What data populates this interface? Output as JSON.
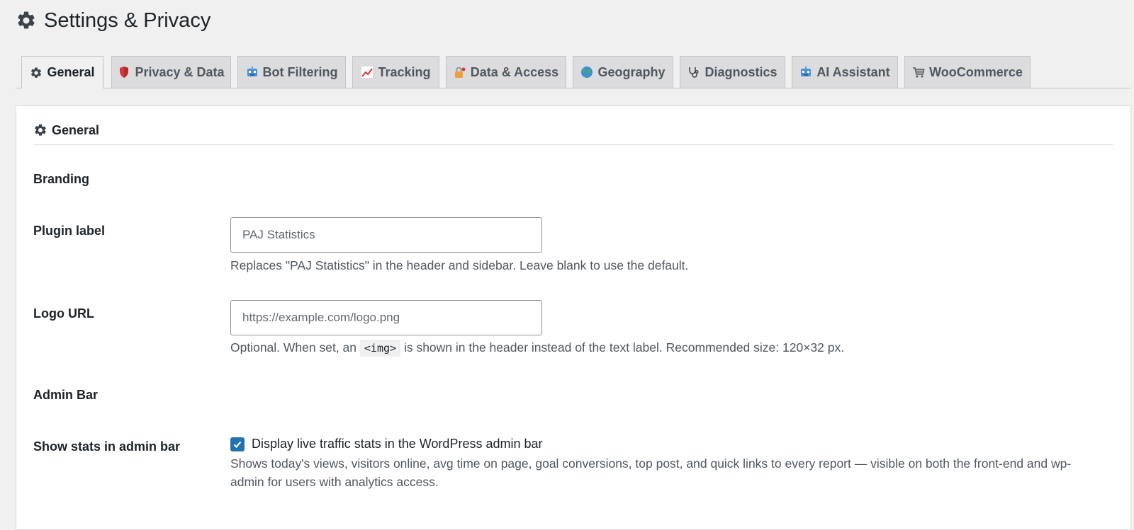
{
  "page": {
    "title": "Settings & Privacy"
  },
  "tabs": [
    {
      "label": "General",
      "icon": "gear-icon",
      "active": true
    },
    {
      "label": "Privacy & Data",
      "icon": "shield-icon",
      "active": false
    },
    {
      "label": "Bot Filtering",
      "icon": "robot-icon",
      "active": false
    },
    {
      "label": "Tracking",
      "icon": "chart-up-icon",
      "active": false
    },
    {
      "label": "Data & Access",
      "icon": "lock-key-icon",
      "active": false
    },
    {
      "label": "Geography",
      "icon": "globe-icon",
      "active": false
    },
    {
      "label": "Diagnostics",
      "icon": "stethoscope-icon",
      "active": false
    },
    {
      "label": "AI Assistant",
      "icon": "robot-icon",
      "active": false
    },
    {
      "label": "WooCommerce",
      "icon": "cart-icon",
      "active": false
    }
  ],
  "section": {
    "title": "General",
    "icon": "gear-icon"
  },
  "branding": {
    "heading": "Branding",
    "plugin_label": {
      "label": "Plugin label",
      "placeholder": "PAJ Statistics",
      "value": "",
      "description": "Replaces \"PAJ Statistics\" in the header and sidebar. Leave blank to use the default."
    },
    "logo_url": {
      "label": "Logo URL",
      "placeholder": "https://example.com/logo.png",
      "value": "",
      "description_before": "Optional. When set, an",
      "description_code": "<img>",
      "description_after": "is shown in the header instead of the text label. Recommended size: 120×32 px."
    }
  },
  "admin_bar": {
    "heading": "Admin Bar",
    "show_stats": {
      "label": "Show stats in admin bar",
      "checkbox_label": "Display live traffic stats in the WordPress admin bar",
      "checked": true,
      "description": "Shows today's views, visitors online, avg time on page, goal conversions, top post, and quick links to every report — visible on both the front-end and wp-admin for users with analytics access."
    }
  },
  "colors": {
    "background": "#f0f0f1",
    "card": "#ffffff",
    "accent": "#2271b1",
    "text": "#1d2327",
    "muted_text": "#50575e"
  }
}
